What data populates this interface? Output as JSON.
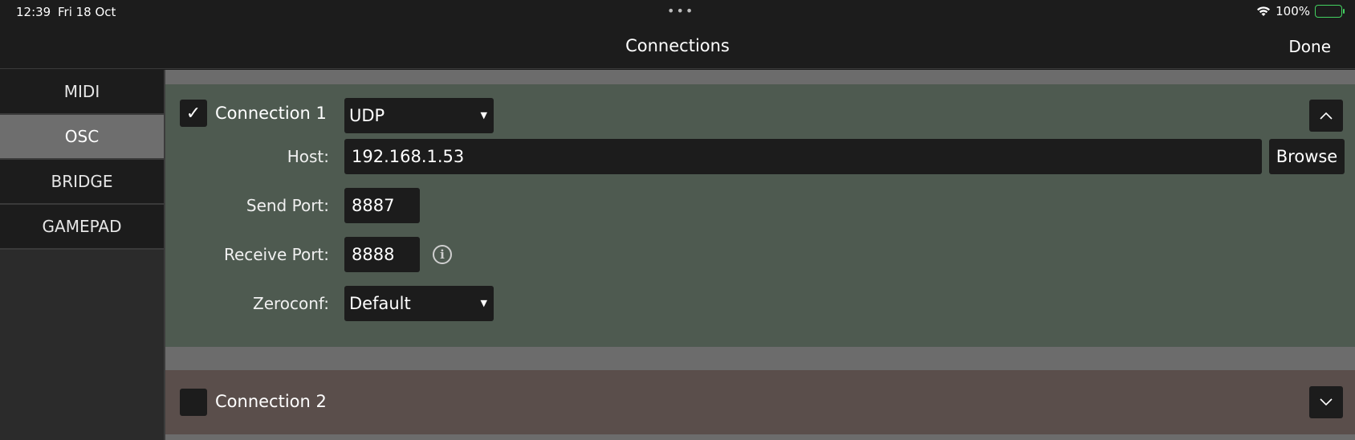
{
  "status_bar": {
    "time": "12:39",
    "date": "Fri 18 Oct",
    "battery": "100%"
  },
  "nav": {
    "title": "Connections",
    "done_label": "Done"
  },
  "sidebar": {
    "items": [
      {
        "label": "MIDI",
        "active": false
      },
      {
        "label": "OSC",
        "active": true
      },
      {
        "label": "BRIDGE",
        "active": false
      },
      {
        "label": "GAMEPAD",
        "active": false
      }
    ]
  },
  "connection1": {
    "enabled_mark": "✓",
    "label": "Connection 1",
    "protocol": "UDP",
    "host_label": "Host:",
    "host_value": "192.168.1.53",
    "browse_label": "Browse",
    "send_port_label": "Send Port:",
    "send_port_value": "8887",
    "receive_port_label": "Receive Port:",
    "receive_port_value": "8888",
    "zeroconf_label": "Zeroconf:",
    "zeroconf_value": "Default",
    "collapse_icon": "chevron-up-icon"
  },
  "connection2": {
    "label": "Connection 2",
    "expand_icon": "chevron-down-icon"
  },
  "colors": {
    "connection1_bg": "#4e5a50",
    "connection2_bg": "#5a4e4b",
    "active_tab_bg": "#6e6e6e",
    "battery": "#43d160"
  }
}
